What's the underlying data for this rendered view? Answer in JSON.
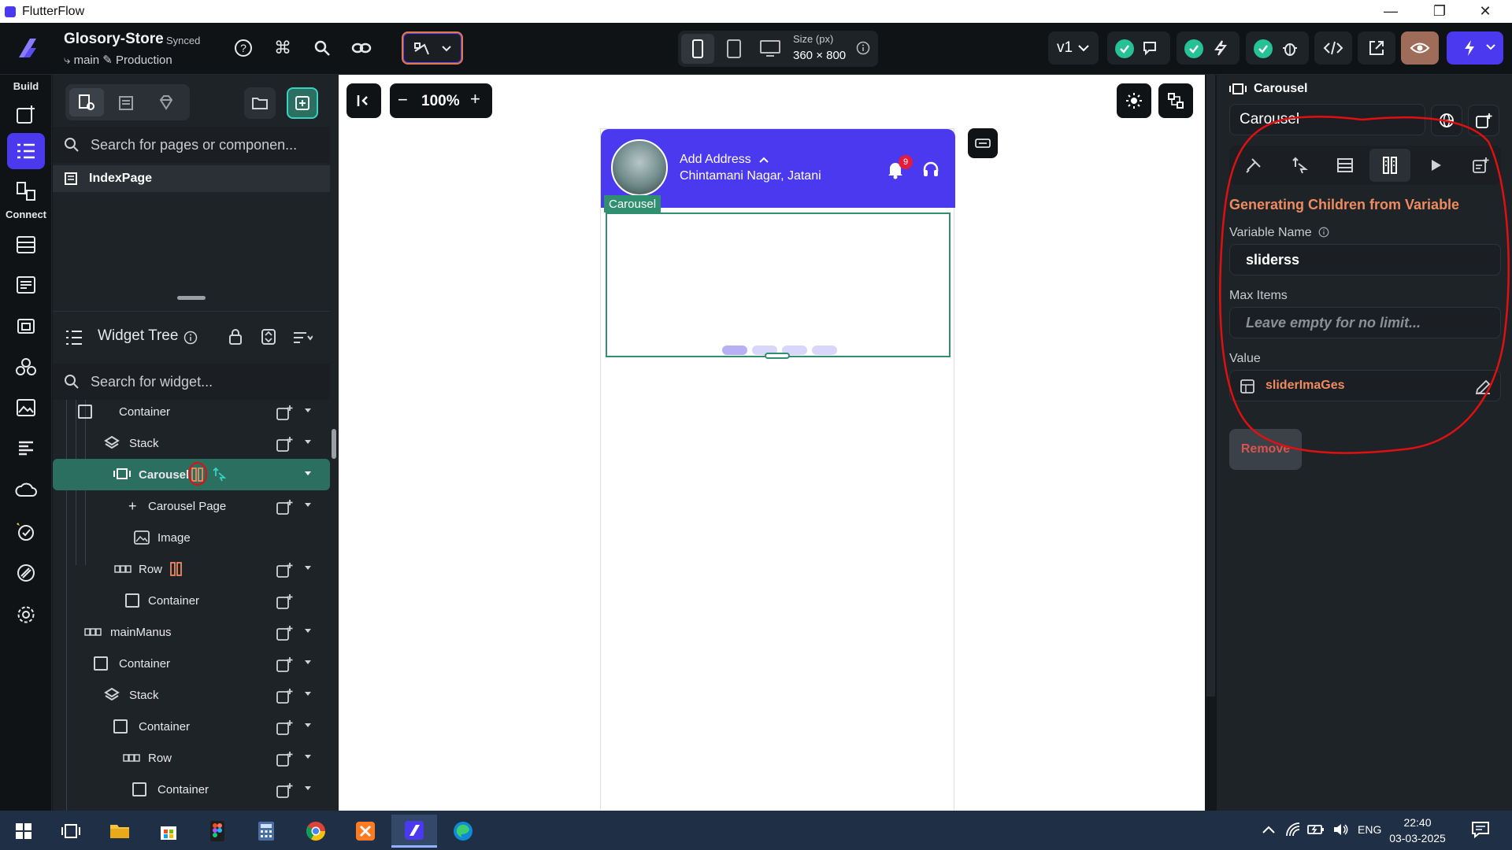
{
  "window": {
    "title": "FlutterFlow"
  },
  "project": {
    "name": "Glosory-Store",
    "sync_status": "Synced",
    "branch": "main",
    "env": "Production"
  },
  "toolbar": {
    "size_label": "Size (px)",
    "size_value": "360 × 800",
    "version": "v1"
  },
  "rail": {
    "section_build": "Build",
    "section_connect": "Connect"
  },
  "left_panel": {
    "search_pages_placeholder": "Search for pages or componen...",
    "page_item": "IndexPage",
    "widget_tree_title": "Widget Tree",
    "search_widget_placeholder": "Search for widget...",
    "tree": [
      {
        "label": "Container"
      },
      {
        "label": "Stack"
      },
      {
        "label": "Carousel"
      },
      {
        "label": "Carousel Page"
      },
      {
        "label": "Image"
      },
      {
        "label": "Row"
      },
      {
        "label": "Container"
      },
      {
        "label": "mainManus"
      },
      {
        "label": "Container"
      },
      {
        "label": "Stack"
      },
      {
        "label": "Container"
      },
      {
        "label": "Row"
      },
      {
        "label": "Container"
      }
    ]
  },
  "canvas": {
    "zoom": "100%",
    "app": {
      "address_title": "Add Address",
      "address_sub": "Chintamani Nagar, Jatani",
      "badge_count": "9",
      "carousel_tag": "Carousel"
    }
  },
  "right_panel": {
    "widget_type": "Carousel",
    "widget_name": "Carousel",
    "heading": "Generating Children from Variable",
    "variable_name_label": "Variable Name",
    "variable_name_value": "sliderss",
    "max_items_label": "Max Items",
    "max_items_placeholder": "Leave empty for no limit...",
    "value_label": "Value",
    "value_value": "sliderImaGes",
    "remove_label": "Remove"
  },
  "taskbar": {
    "lang": "ENG",
    "time": "22:40",
    "date": "03-03-2025"
  },
  "colors": {
    "accent": "#4b39ef",
    "teal": "#2f8f6f",
    "orange": "#ee8b60",
    "annotation": "#e01010"
  }
}
